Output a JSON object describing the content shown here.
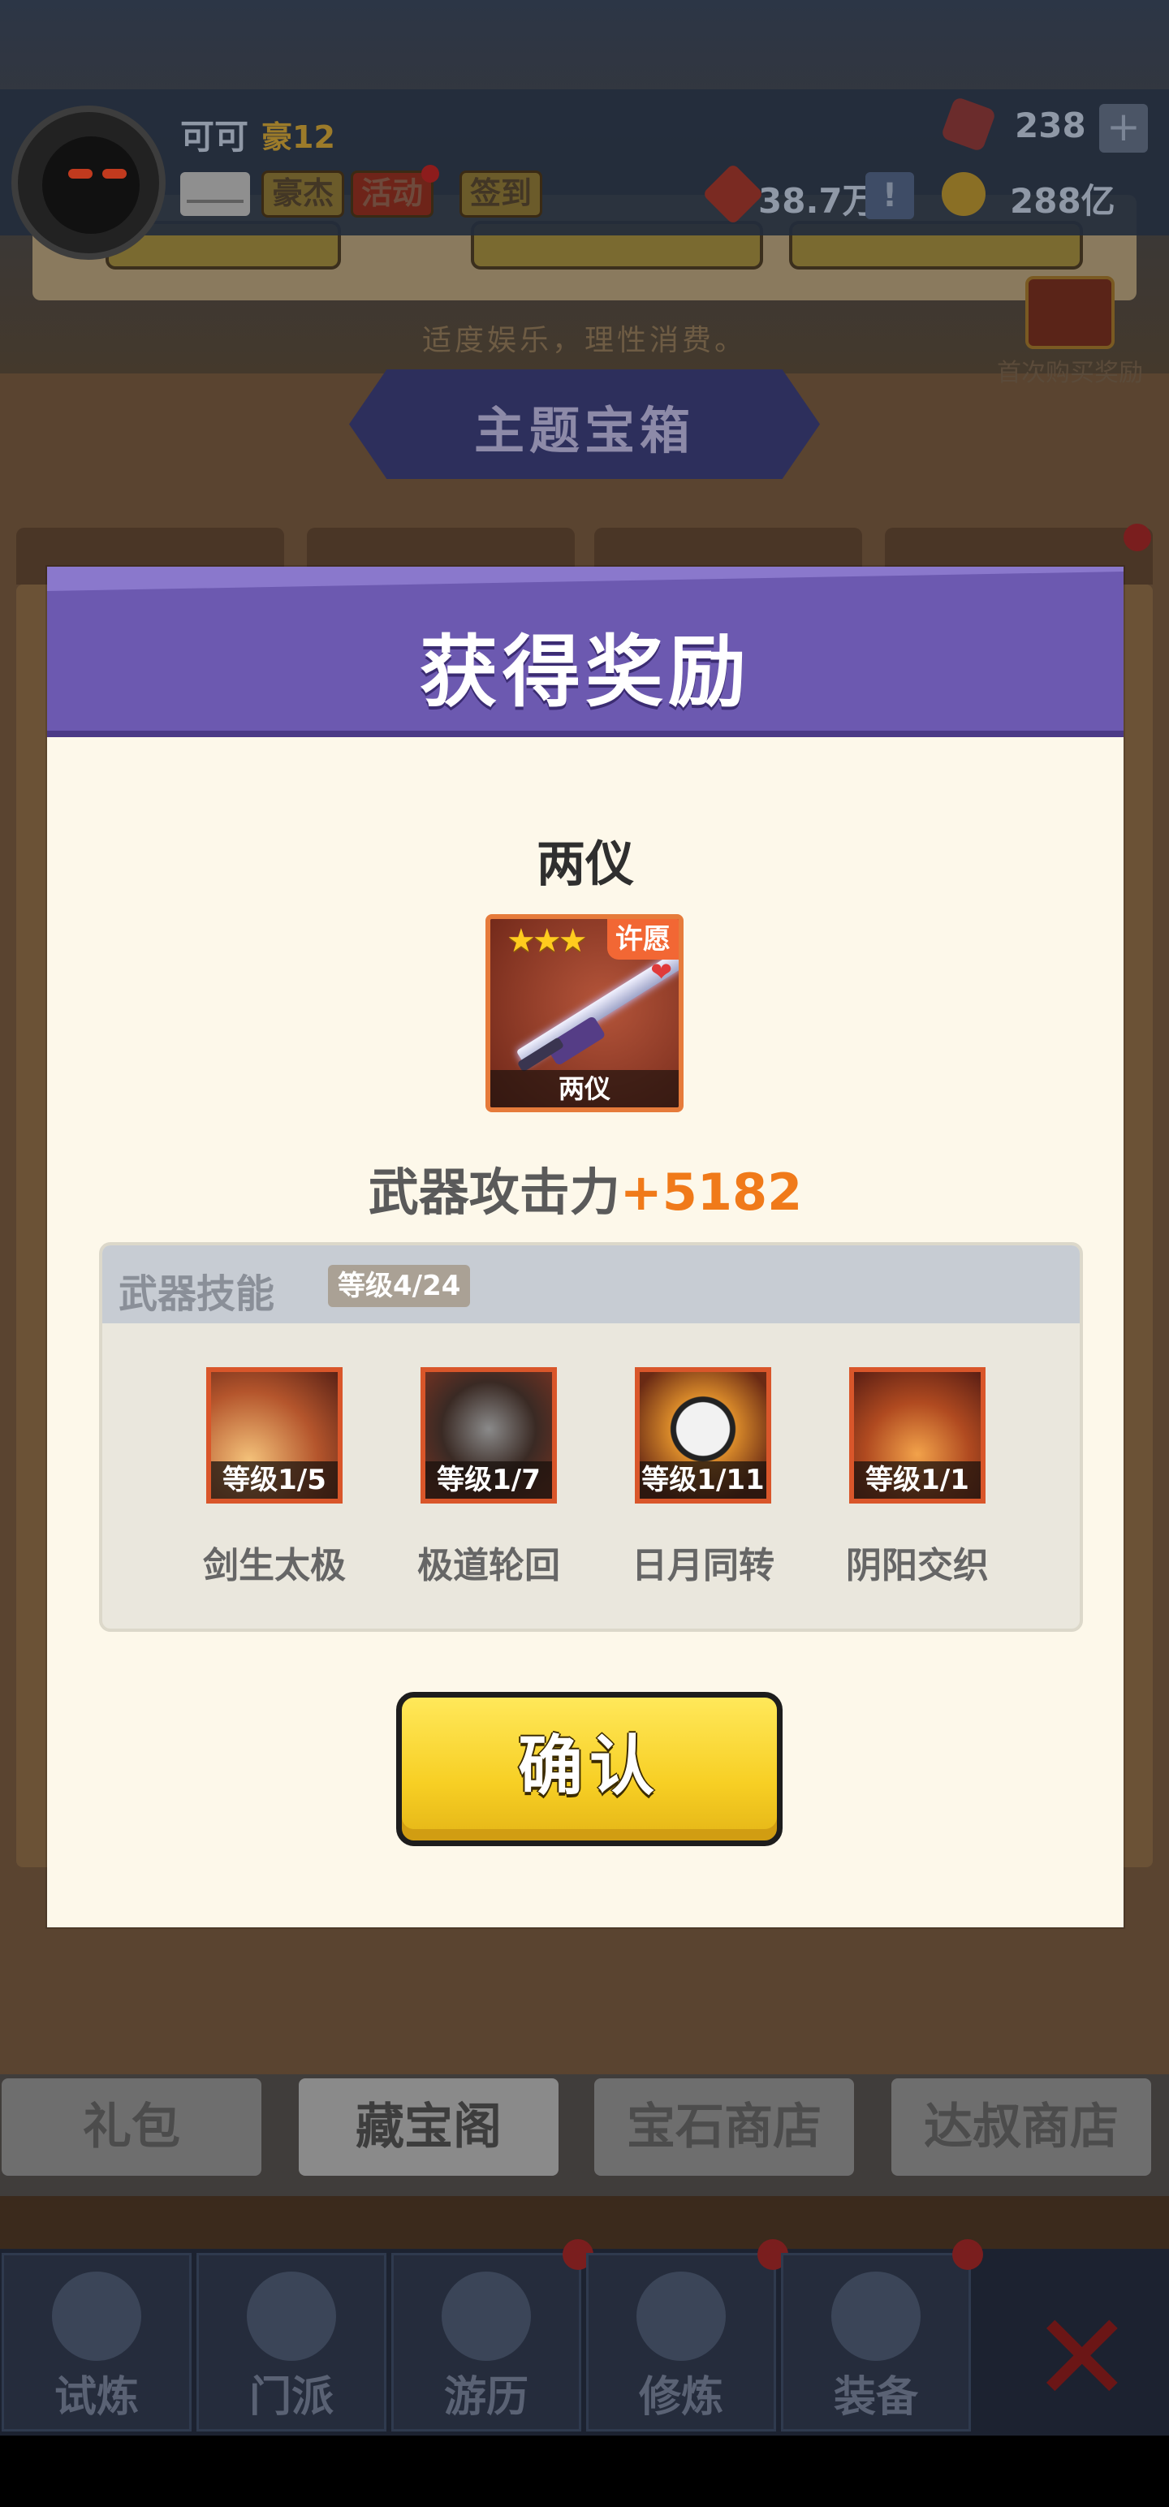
{
  "header": {
    "player_name": "可可",
    "rank": "豪12",
    "buttons": [
      "豪杰",
      "活动",
      "签到"
    ],
    "gems": "238",
    "plus": "+",
    "coin_a": "38.7万",
    "alert": "!",
    "gold": "288亿"
  },
  "shop": {
    "hint": "适度娱乐，理性消费。",
    "first_buy_label": "首次购买奖励",
    "theme_title": "主题宝箱",
    "bottom_tabs": [
      "礼包",
      "藏宝阁",
      "宝石商店",
      "达叔商店"
    ]
  },
  "nav": {
    "items": [
      "试炼",
      "门派",
      "游历",
      "修炼",
      "装备"
    ],
    "close": "✕"
  },
  "modal": {
    "title": "获得奖励",
    "item_name": "两仪",
    "card": {
      "stars": "★★★",
      "badge": "许愿",
      "caption": "两仪"
    },
    "attack_label": "武器攻击力",
    "attack_value": "+5182",
    "skills_title": "武器技能",
    "skills_level": "等级4/24",
    "skills": [
      {
        "level": "等级1/5",
        "name": "剑生太极"
      },
      {
        "level": "等级1/7",
        "name": "极道轮回"
      },
      {
        "level": "等级1/11",
        "name": "日月同转"
      },
      {
        "level": "等级1/1",
        "name": "阴阳交织"
      }
    ],
    "confirm": "确认"
  }
}
